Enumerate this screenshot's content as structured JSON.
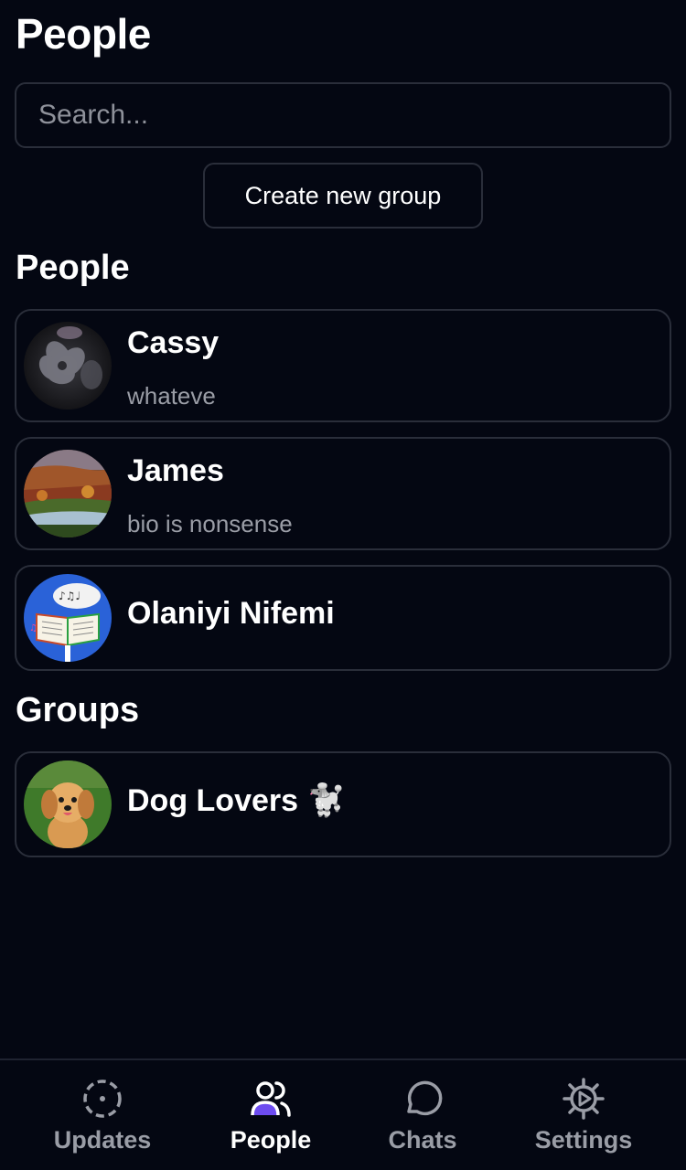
{
  "header": {
    "title": "People"
  },
  "search": {
    "placeholder": "Search..."
  },
  "actions": {
    "create_group_label": "Create new group"
  },
  "people_section": {
    "title": "People",
    "items": [
      {
        "name": "Cassy",
        "bio": "whateve"
      },
      {
        "name": "James",
        "bio": "bio is nonsense"
      },
      {
        "name": "Olaniyi Nifemi"
      }
    ]
  },
  "groups_section": {
    "title": "Groups",
    "items": [
      {
        "name": "Dog Lovers 🐩"
      }
    ]
  },
  "nav": {
    "items": [
      {
        "label": "Updates",
        "icon": "updates-icon"
      },
      {
        "label": "People",
        "icon": "people-icon",
        "active": true
      },
      {
        "label": "Chats",
        "icon": "chat-icon"
      },
      {
        "label": "Settings",
        "icon": "gear-icon"
      }
    ]
  },
  "colors": {
    "background": "#040712",
    "border": "#2a2e3a",
    "accent": "#6d4cf0",
    "muted": "#9a9da6"
  }
}
